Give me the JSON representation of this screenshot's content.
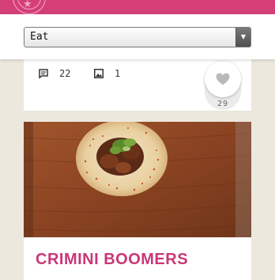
{
  "filter": {
    "selected": "Eat"
  },
  "post": {
    "comments": "22",
    "photos": "1",
    "likes": "29"
  },
  "next_post": {
    "title": "CRIMINI BOOMERS",
    "image": "taco-on-wooden-board"
  },
  "colors": {
    "brand": "#d43f78",
    "title": "#c93777"
  }
}
